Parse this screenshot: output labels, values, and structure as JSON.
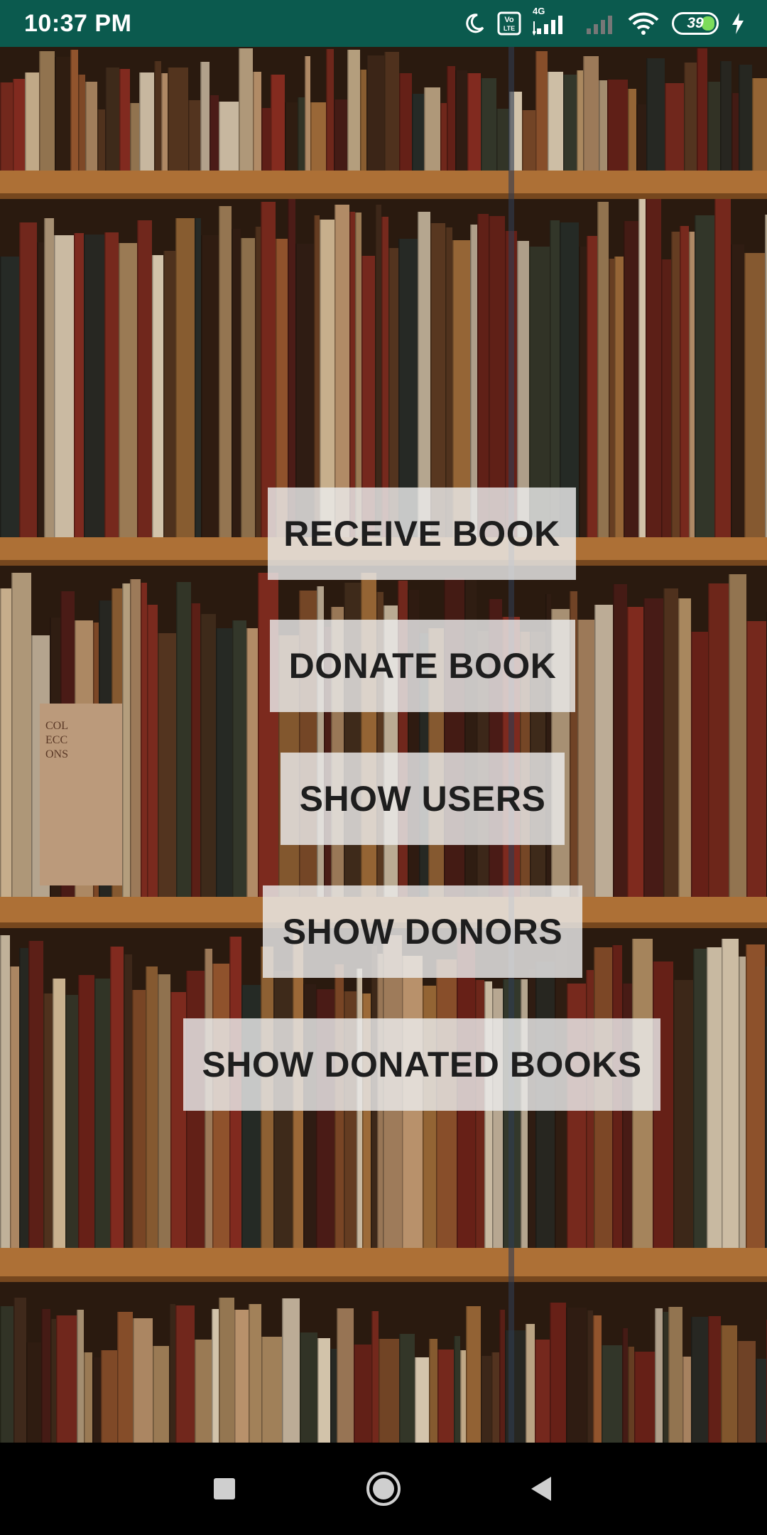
{
  "status_bar": {
    "time": "10:37 PM",
    "network_label": "4G",
    "volte_label": "Vo LTE",
    "battery_level": "39",
    "icons": [
      "moon-icon",
      "volte-icon",
      "signal-icon",
      "signal-empty-icon",
      "wifi-icon",
      "battery-icon",
      "charging-icon"
    ]
  },
  "background": {
    "cover_text": "COL\nECC\nONS"
  },
  "menu": {
    "receive_book": "RECEIVE BOOK",
    "donate_book": "DONATE BOOK",
    "show_users": "SHOW USERS",
    "show_donors": "SHOW DONORS",
    "show_donated_books": "SHOW DONATED BOOKS"
  },
  "nav_bar": {
    "icons": [
      "recent-apps-icon",
      "home-icon",
      "back-icon"
    ]
  },
  "colors": {
    "status_bar": "#0b5a4e",
    "button_bg": "#ebebeb",
    "button_text": "#1e1e1e",
    "shelf_wood": "#b9793c"
  }
}
